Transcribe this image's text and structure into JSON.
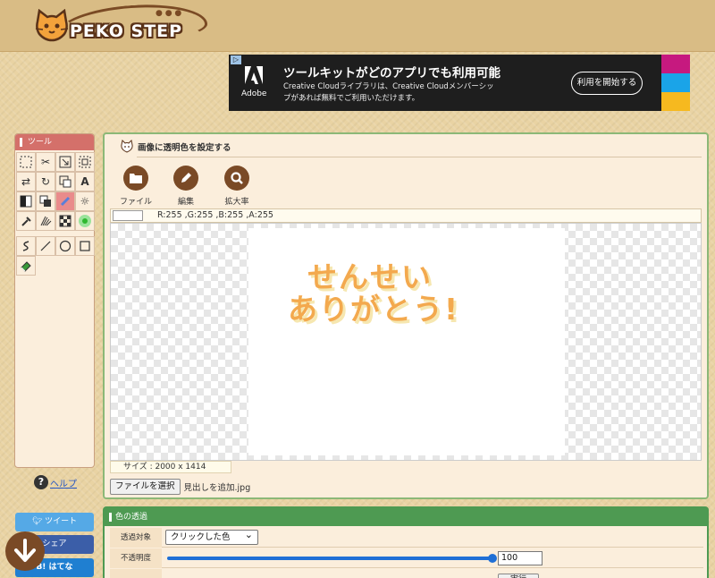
{
  "header": {
    "logo_text": "PEKO STEP"
  },
  "ad": {
    "badge": "▷",
    "brand": "Adobe",
    "headline": "ツールキットがどのアプリでも利用可能",
    "body": "Creative Cloudライブラリは、Creative Cloudメンバーシップがあれば無料でご利用いただけます。",
    "button": "利用を開始する",
    "strip_colors": [
      "#c6197f",
      "#1aa4e8",
      "#f6b91f"
    ]
  },
  "tools": {
    "title": "ツール"
  },
  "help": {
    "icon": "?",
    "label": "ヘルプ"
  },
  "social": {
    "tweet": "ツイート",
    "share": "シェア",
    "hatena": "B! はてな"
  },
  "main": {
    "title": "画像に透明色を設定する",
    "menu": {
      "file": "ファイル",
      "edit": "編集",
      "zoom": "拡大率"
    },
    "color_readout": "R:255 ,G:255 ,B:255 ,A:255",
    "image_text_line1": "せんせい",
    "image_text_line2": "ありがとう!",
    "size": "サイズ : 2000 x 1414",
    "file_button": "ファイルを選択",
    "file_name": "見出しを追加.jpg"
  },
  "transparency": {
    "title": "色の透過",
    "target_label": "透過対象",
    "target_value": "クリックした色",
    "opacity_label": "不透明度",
    "opacity_value": "100",
    "opacity_fraction": 1.0,
    "exec_button": "実行"
  }
}
